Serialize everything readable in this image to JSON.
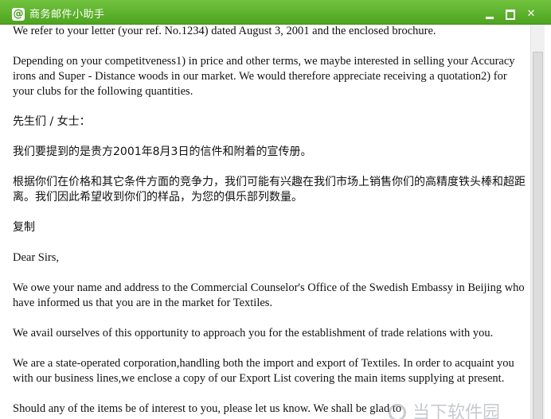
{
  "window": {
    "title": "商务邮件小助手",
    "app_icon": "@",
    "icon_names": {
      "app": "at-sign-icon",
      "minimize": "minimize-icon",
      "maximize": "maximize-icon",
      "close": "close-icon"
    },
    "close_glyph": "✕",
    "accent_color": "#4ea51f"
  },
  "body": {
    "paragraphs": [
      "We refer to your letter (your ref. No.1234) dated August 3, 2001 and the enclosed brochure.",
      "Depending on your competitveness1) in price and other terms, we maybe interested in selling your Accuracy irons and Super - Distance woods in our market. We would therefore appreciate receiving a quotation2) for your clubs for the following quantities.",
      "先生们 / 女士：",
      " 我们要提到的是贵方2001年8月3日的信件和附着的宣传册。",
      "根据你们在价格和其它条件方面的竞争力，我们可能有兴趣在我们市场上销售你们的高精度铁头棒和超距离。我们因此希望收到你们的样品，为您的俱乐部列数量。",
      "复制",
      "Dear Sirs,",
      "We owe  your name and address to the Commercial  Counselor's Office of the Swedish Embassy in Beijing who have informed us that you are in the market for Textiles.",
      "We avail ourselves of this opportunity to approach  you for the establishment of trade relations with you.",
      "We are a state-operated corporation,handling both the import and export of Textiles. In order to acquaint you with our business lines,we enclose a copy of our Export List covering the main items supplying at present.",
      "Should any of the items be of interest to you, please let us know. We shall be glad to"
    ]
  },
  "watermark": {
    "text": "当下软件园"
  }
}
